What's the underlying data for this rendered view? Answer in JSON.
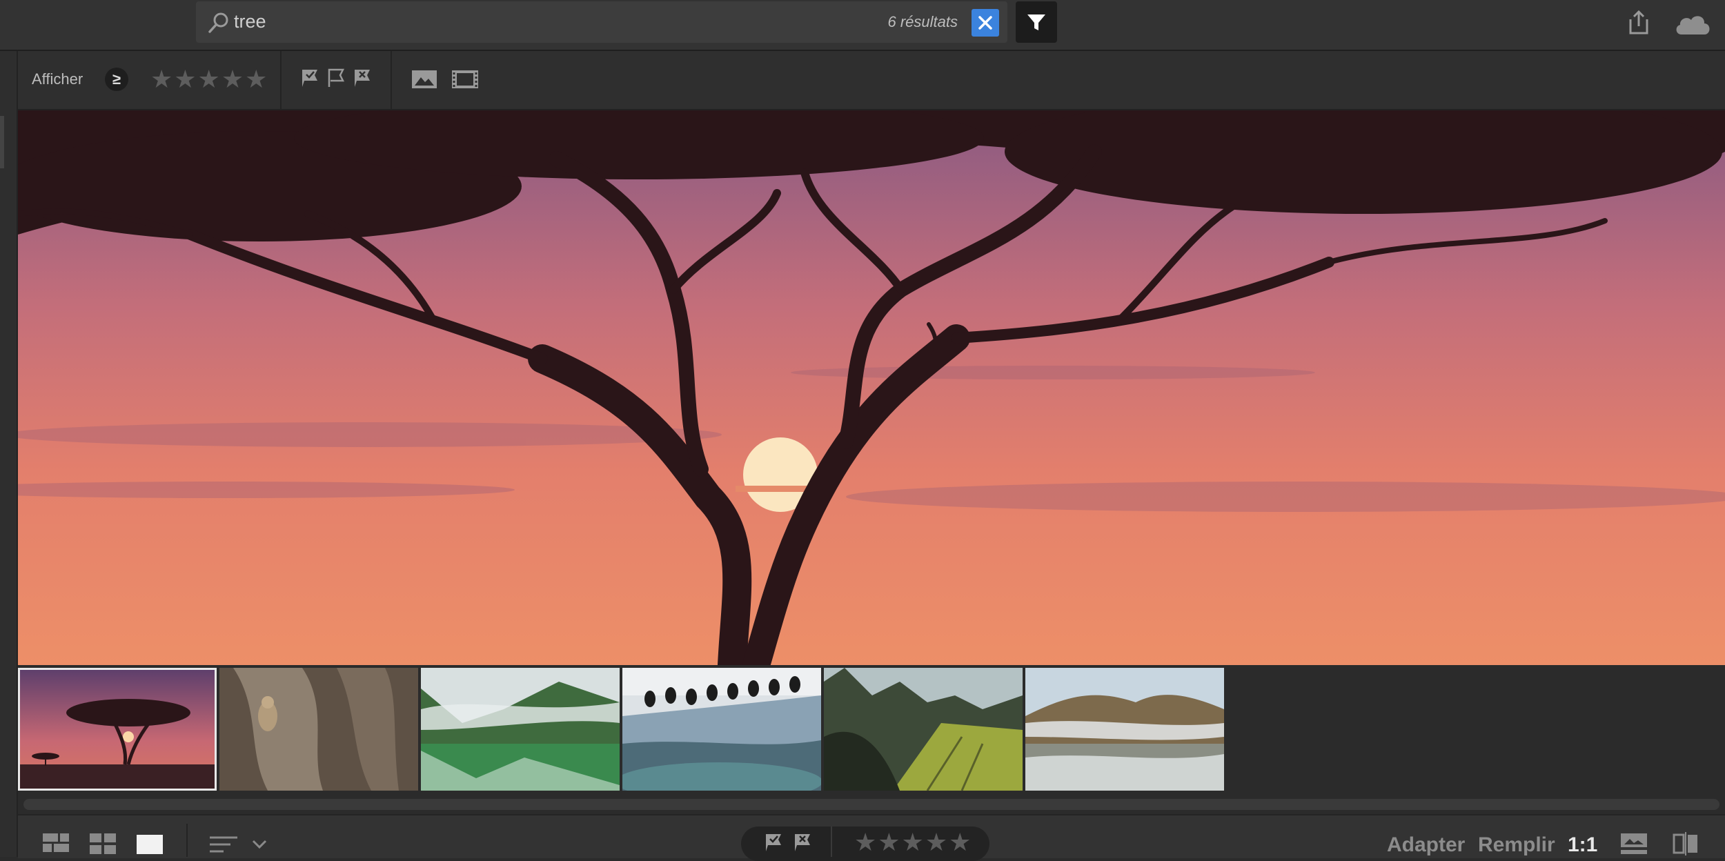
{
  "search": {
    "query": "tree",
    "result_count": "6 résultats"
  },
  "filter_bar": {
    "show_label": "Afficher",
    "rating_operator": "≥",
    "rating_stars": "★★★★★"
  },
  "thumbnails": [
    {
      "name": "thumb-acacia-sunset",
      "selected": true
    },
    {
      "name": "thumb-leopard-tree",
      "selected": false
    },
    {
      "name": "thumb-mountain-lake",
      "selected": false
    },
    {
      "name": "thumb-penguins",
      "selected": false
    },
    {
      "name": "thumb-karst-valley",
      "selected": false
    },
    {
      "name": "thumb-misty-hills",
      "selected": false
    }
  ],
  "bottom_bar": {
    "rating_stars": "★★★★★",
    "fit_label": "Adapter",
    "fill_label": "Remplir",
    "zoom_label": "1:1"
  },
  "colors": {
    "accent": "#3b83de",
    "background": "#2b2b2b",
    "selected_outline": "#e8e8e8"
  }
}
